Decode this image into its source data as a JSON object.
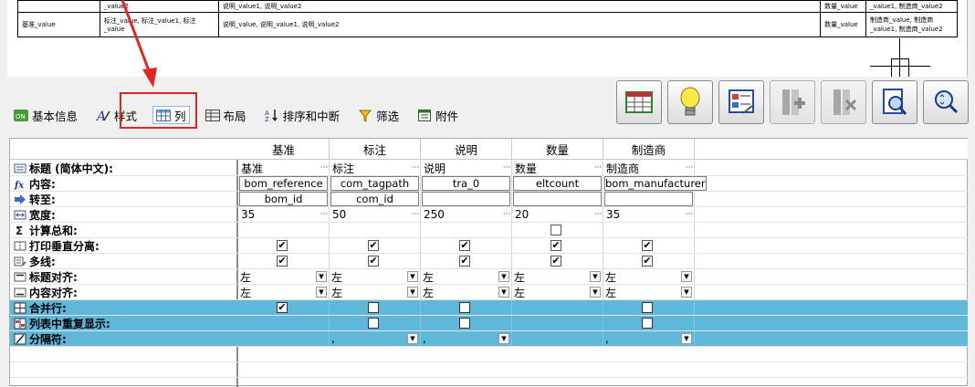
{
  "preview": {
    "row1": [
      "",
      "_value2",
      "",
      "说明_value1, 说明_value2",
      "",
      "数量_value",
      "_value1, 制造商_value2"
    ],
    "row2": [
      "基准_value",
      "标注_value, 标注_value1, 标注_value",
      "说明_value, 说明_value1, 说明_value2",
      "数量_value",
      "制造商_value, 制造商_value1, 制造商_value2"
    ]
  },
  "tabs": [
    {
      "label": "基本信息",
      "icon": "basic-info-icon"
    },
    {
      "label": "样式",
      "icon": "style-icon"
    },
    {
      "label": "列",
      "icon": "columns-icon"
    },
    {
      "label": "布局",
      "icon": "layout-icon"
    },
    {
      "label": "排序和中断",
      "icon": "sort-icon"
    },
    {
      "label": "筛选",
      "icon": "filter-icon"
    },
    {
      "label": "附件",
      "icon": "attachment-icon"
    }
  ],
  "toolbar": [
    "table-icon",
    "lightbulb-icon",
    "form-icon",
    "insert-column-icon",
    "delete-column-icon",
    "preview-icon",
    "zoom-icon"
  ],
  "grid": {
    "columns": [
      "基准",
      "标注",
      "说明",
      "数量",
      "制造商"
    ],
    "labels": {
      "title": "标题 (简体中文):",
      "content": "内容:",
      "goto": "转至:",
      "width": "宽度:",
      "sum": "计算总和:",
      "print_split": "打印垂直分离:",
      "multiline": "多线:",
      "title_align": "标题对齐:",
      "content_align": "内容对齐:",
      "merge": "合并行:",
      "repeat": "列表中重复显示:",
      "separator": "分隔符:"
    },
    "title_row": [
      "基准",
      "标注",
      "说明",
      "数量",
      "制造商"
    ],
    "content_row": [
      "bom_reference",
      "com_tagpath",
      "tra_0",
      "eltcount",
      "bom_manufacturer"
    ],
    "goto_row": [
      "bom_id",
      "com_id",
      "",
      "",
      ""
    ],
    "width_row": [
      "35",
      "50",
      "250",
      "20",
      "35"
    ],
    "align_value": "左",
    "separator_value": ","
  }
}
